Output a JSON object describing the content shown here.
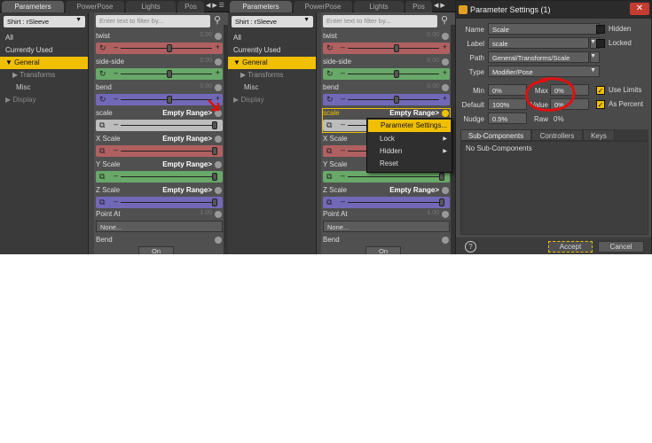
{
  "panels": {
    "tabs": [
      "Parameters",
      "PowerPose",
      "Lights",
      "Pos"
    ],
    "figure": "Shirt : rSleeve",
    "filter_placeholder": "Enter text to filter by...",
    "tree": {
      "all": "All",
      "used": "Currently Used",
      "general": "General",
      "transforms": "Transforms",
      "misc": "Misc",
      "display": "Display"
    },
    "params": {
      "twist": "twist",
      "side_side": "side-side",
      "bend": "bend",
      "scale": "scale",
      "x_scale": "X Scale",
      "y_scale": "Y Scale",
      "z_scale": "Z Scale",
      "point_at": "Point At",
      "bend2": "Bend",
      "zero": "0.00",
      "one": "1.00",
      "empty_range": "Empty Range>",
      "none": "None...",
      "on": "On"
    },
    "context_menu": {
      "settings": "Parameter Settings...",
      "lock": "Lock",
      "hidden": "Hidden",
      "reset": "Reset"
    }
  },
  "dialog": {
    "title": "Parameter Settings (1)",
    "close": "✕",
    "name_label": "Name",
    "name_value": "Scale",
    "label_label": "Label",
    "label_value": "scale",
    "path_label": "Path",
    "path_value": "General/Transforms/Scale",
    "type_label": "Type",
    "type_value": "Modifier/Pose",
    "hidden": "Hidden",
    "locked": "Locked",
    "min_label": "Min",
    "min_value": "0%",
    "max_label": "Max",
    "max_value": "0%",
    "default_label": "Default",
    "default_value": "100%",
    "value_label": "Value",
    "value_value": "0%",
    "nudge_label": "Nudge",
    "nudge_value": "0.5%",
    "raw_label": "Raw",
    "raw_value": "0%",
    "use_limits": "Use Limits",
    "as_percent": "As Percent",
    "tabs": [
      "Sub-Components",
      "Controllers",
      "Keys"
    ],
    "no_sub": "No Sub-Components",
    "help": "?",
    "accept": "Accept",
    "cancel": "Cancel"
  },
  "colors": {
    "accent": "#f0c000",
    "annotation": "#e01010"
  }
}
